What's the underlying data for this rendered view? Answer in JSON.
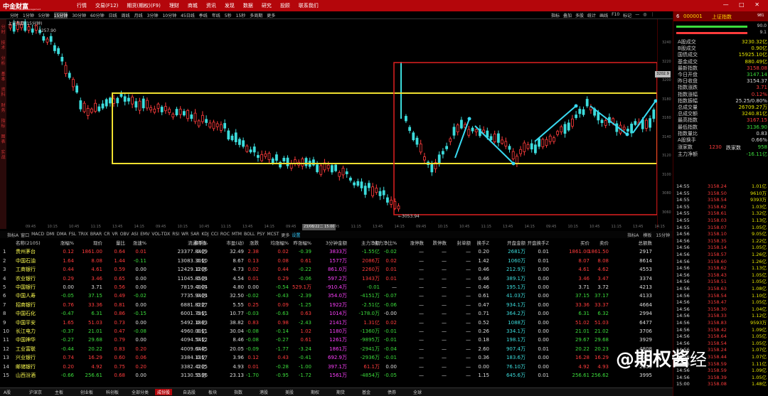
{
  "app": {
    "logo_text": "中金财富",
    "logo_sub": "CICC Wealth Management",
    "menu": [
      "行情",
      "交易(F12)",
      "期货(期权)(F9)",
      "理财",
      "商城",
      "资讯",
      "发现",
      "数据",
      "研究",
      "投顾",
      "联系我们"
    ],
    "window_controls": "— □ ✕"
  },
  "periods": {
    "items": [
      "分时",
      "1分钟",
      "5分钟",
      "15分钟",
      "30分钟",
      "60分钟",
      "日线",
      "周线",
      "月线",
      "3分钟",
      "10分钟",
      "45日线",
      "季线",
      "年线",
      "5秒",
      "15秒",
      "多周期",
      "更多"
    ],
    "active": "15分钟"
  },
  "tools": [
    "指标",
    "叠加",
    "多股",
    "统计",
    "画线",
    "F10",
    "标记",
    "—",
    "◎",
    "⋮"
  ],
  "chart": {
    "title": "上证指数(15分钟)",
    "left_labels": [
      "分时",
      "技术",
      "分析",
      "基本",
      "资料",
      "财务",
      "指标",
      "图表",
      "实战"
    ],
    "y_ticks": [
      "3240",
      "3220",
      "3200",
      "3180",
      "3160",
      "3140",
      "3120",
      "3100",
      "3080",
      "3060"
    ],
    "price_label": "3202.9",
    "low_label": "←3053.94",
    "high_label": "3257.90",
    "time_ticks": [
      "09:45",
      "10:15",
      "10:45",
      "11:15",
      "13:45",
      "14:15",
      "09:45",
      "10:15",
      "10:45",
      "11:15",
      "13:45",
      "14:15",
      "09:45",
      "10:15",
      "10:45",
      "11:15",
      "13:45",
      "14:15",
      "09:45",
      "10:15",
      "10:45",
      "11:15",
      "13:45",
      "14:15",
      "09:45",
      "10:15",
      "10:45",
      "11:15",
      "13:45",
      "14:15",
      "15:00"
    ],
    "date_highlight": "23/08/22二 15:00"
  },
  "indicators": {
    "items": [
      "指标A",
      "窗口",
      "MACD",
      "DMI",
      "DMA",
      "FSL",
      "TRIX",
      "BRAR",
      "CR",
      "VR",
      "OBV",
      "ASI",
      "EMV",
      "VOL-TDX",
      "RSI",
      "WR",
      "SAR",
      "KDJ",
      "CCI",
      "ROC",
      "MTM",
      "BOLL",
      "PSY",
      "MCST",
      "更多",
      "设置"
    ],
    "right": [
      "指标A",
      "模板",
      "15分钟"
    ]
  },
  "table": {
    "headers": [
      "名称(2105)",
      "涨幅%",
      "现价",
      "量比",
      "涨速%",
      "流通市值",
      "换手%",
      "市盈(动)",
      "涨跌",
      "均涨幅%",
      "昨涨幅%",
      "3分钟金额",
      "主力净额",
      "主力净比%",
      "涨停数",
      "跌停数",
      "封单额",
      "换手Z",
      "开盘金额",
      "开盘换手Z",
      "买价",
      "卖价",
      "总额数"
    ],
    "rows": [
      {
        "idx": "1",
        "name": "贵州茅台",
        "c": [
          "0.12",
          "1861.00",
          "0.64",
          "0.01",
          "23377.84亿",
          "0.09",
          "32.49",
          "2.38",
          "0.02",
          "-0.39",
          "3833万",
          "-1.55亿",
          "-0.02",
          "—",
          "—",
          "—",
          "0.20",
          "2681万",
          "0.01",
          "1861.00",
          "1861.50",
          "2917"
        ]
      },
      {
        "idx": "2",
        "name": "中国石油",
        "c": [
          "1.64",
          "8.08",
          "1.44",
          "-0.11",
          "13083.30亿",
          "0.10",
          "8.67",
          "0.13",
          "0.08",
          "0.61",
          "1577万",
          "2086万",
          "0.02",
          "—",
          "—",
          "—",
          "1.42",
          "1060万",
          "0.01",
          "8.07",
          "8.08",
          "8614"
        ]
      },
      {
        "idx": "3",
        "name": "工商银行",
        "c": [
          "0.44",
          "4.61",
          "0.59",
          "0.00",
          "12429.12亿",
          "0.06",
          "4.73",
          "0.02",
          "0.44",
          "-0.22",
          "861.0万",
          "2260万",
          "0.01",
          "—",
          "—",
          "—",
          "0.46",
          "212.9万",
          "0.00",
          "4.61",
          "4.62",
          "4553"
        ]
      },
      {
        "idx": "4",
        "name": "农业银行",
        "c": [
          "0.29",
          "3.46",
          "0.65",
          "0.00",
          "11045.85亿",
          "0.04",
          "4.54",
          "0.01",
          "0.29",
          "-0.06",
          "597.2万",
          "1343万",
          "0.01",
          "—",
          "—",
          "—",
          "0.46",
          "389.1万",
          "0.00",
          "3.46",
          "3.47",
          "3374"
        ]
      },
      {
        "idx": "5",
        "name": "中国银行",
        "c": [
          "0.00",
          "3.71",
          "0.56",
          "0.00",
          "7819.40亿",
          "0.04",
          "4.80",
          "0.00",
          "-0.54",
          "529.1万",
          "-910.4万",
          "-0.01",
          "—",
          "—",
          "—",
          "—",
          "0.46",
          "195.1万",
          "0.00",
          "3.71",
          "3.72",
          "4213"
        ]
      },
      {
        "idx": "6",
        "name": "中国人寿",
        "c": [
          "-0.05",
          "37.15",
          "0.49",
          "-0.02",
          "7735.94亿",
          "0.04",
          "32.50",
          "-0.02",
          "-0.43",
          "-2.39",
          "354.0万",
          "-4151万",
          "-0.07",
          "—",
          "—",
          "—",
          "0.61",
          "41.03万",
          "0.00",
          "37.15",
          "37.17",
          "4133"
        ]
      },
      {
        "idx": "7",
        "name": "招商银行",
        "c": [
          "0.76",
          "33.36",
          "0.81",
          "0.00",
          "6881.82亿",
          "0.27",
          "5.55",
          "0.25",
          "0.09",
          "-1.25",
          "1922万",
          "-2.51亿",
          "-0.06",
          "—",
          "—",
          "—",
          "0.47",
          "934.1万",
          "0.00",
          "33.36",
          "33.37",
          "4664"
        ]
      },
      {
        "idx": "8",
        "name": "中国石化",
        "c": [
          "-0.47",
          "6.31",
          "0.86",
          "-0.15",
          "6001.79亿",
          "0.11",
          "10.77",
          "-0.03",
          "-0.63",
          "0.63",
          "1014万",
          "-178.0万",
          "-0.00",
          "—",
          "—",
          "—",
          "0.71",
          "364.2万",
          "0.00",
          "6.31",
          "6.32",
          "2994"
        ]
      },
      {
        "idx": "9",
        "name": "中国平安",
        "c": [
          "1.65",
          "51.03",
          "0.73",
          "0.00",
          "5492.18亿",
          "0.43",
          "38.82",
          "0.83",
          "0.98",
          "-2.43",
          "2141万",
          "1.31亿",
          "0.02",
          "—",
          "—",
          "—",
          "0.52",
          "1088万",
          "0.00",
          "51.02",
          "51.03",
          "6477"
        ]
      },
      {
        "idx": "10",
        "name": "长江电力",
        "c": [
          "-0.37",
          "21.01",
          "0.47",
          "-0.08",
          "4960.00亿",
          "0.11",
          "30.04",
          "-0.08",
          "-0.14",
          "1.02",
          "1180万",
          "-1360万",
          "-0.01",
          "—",
          "—",
          "—",
          "0.26",
          "334.1万",
          "0.00",
          "21.01",
          "21.02",
          "3706"
        ]
      },
      {
        "idx": "11",
        "name": "中国神华",
        "c": [
          "-0.27",
          "29.68",
          "0.79",
          "0.00",
          "4094.54亿",
          "0.12",
          "8.46",
          "-0.08",
          "-0.27",
          "0.61",
          "1261万",
          "-9895万",
          "-0.01",
          "—",
          "—",
          "—",
          "0.18",
          "198.1万",
          "0.00",
          "29.67",
          "29.68",
          "3929"
        ]
      },
      {
        "idx": "12",
        "name": "工业富联",
        "c": [
          "-0.44",
          "20.22",
          "0.83",
          "0.20",
          "4009.64亿",
          "0.45",
          "20.05",
          "-0.09",
          "-1.77",
          "-3.24",
          "1861万",
          "-2941万",
          "-0.04",
          "—",
          "—",
          "—",
          "2.60",
          "907.4万",
          "0.01",
          "20.22",
          "20.23",
          "4808"
        ]
      },
      {
        "idx": "13",
        "name": "兴业银行",
        "c": [
          "0.74",
          "16.29",
          "0.60",
          "0.06",
          "3384.13亿",
          "0.17",
          "3.96",
          "0.12",
          "0.43",
          "-0.41",
          "692.9万",
          "-2936万",
          "-0.01",
          "—",
          "—",
          "—",
          "0.36",
          "183.6万",
          "0.00",
          "16.28",
          "16.29",
          "3725"
        ]
      },
      {
        "idx": "14",
        "name": "邮储银行",
        "c": [
          "0.20",
          "4.92",
          "0.75",
          "0.20",
          "3382.42亿",
          "0.05",
          "4.93",
          "0.01",
          "-0.28",
          "-1.00",
          "397.1万",
          "61.1万",
          "0.00",
          "—",
          "—",
          "—",
          "0.00",
          "76.10万",
          "0.00",
          "4.92",
          "4.93",
          "2659"
        ]
      },
      {
        "idx": "15",
        "name": "山西汾酒",
        "c": [
          "-0.66",
          "256.61",
          "0.68",
          "0.00",
          "3130.55亿",
          "0.36",
          "23.13",
          "-1.70",
          "-0.95",
          "-1.72",
          "1561万",
          "-4854万",
          "-0.05",
          "—",
          "—",
          "—",
          "1.15",
          "645.6万",
          "0.01",
          "256.61",
          "256.62",
          "3995"
        ]
      }
    ]
  },
  "bottom_tabs": [
    "A股",
    "沪深京",
    "主板",
    "创业板",
    "科创板",
    "全部分类",
    "成份股",
    "自选股",
    "板块",
    "指数",
    "港股",
    "美股",
    "期权",
    "期货",
    "基金",
    "债券",
    "全球"
  ],
  "bottom_active": "成份股",
  "right_panel": {
    "head_num": "6",
    "code": "000001",
    "name": "上证指数",
    "right": "981",
    "mini": [
      "90.0",
      "9.1"
    ],
    "stats": [
      {
        "k": "A股成交",
        "v": "3230.32亿",
        "c": "yl"
      },
      {
        "k": "B股成交",
        "v": "0.90亿",
        "c": "yl"
      },
      {
        "k": "国债成交",
        "v": "15925.10亿",
        "c": "yl"
      },
      {
        "k": "基金成交",
        "v": "880.49亿",
        "c": "yl"
      },
      {
        "k": "最新指数",
        "v": "3158.08",
        "c": "up"
      },
      {
        "k": "今日开盘",
        "v": "3147.14",
        "c": "dn"
      },
      {
        "k": "昨日收盘",
        "v": "3154.37",
        "c": "wh"
      },
      {
        "k": "指数涨跌",
        "v": "3.71",
        "c": "up"
      },
      {
        "k": "指数涨幅",
        "v": "0.12%",
        "c": "up"
      },
      {
        "k": "指数振幅",
        "v": "25.25/0.80%",
        "c": "wh"
      },
      {
        "k": "总成交量",
        "v": "26709.27万",
        "c": "yl"
      },
      {
        "k": "总成交额",
        "v": "3240.81亿",
        "c": "yl"
      },
      {
        "k": "最高指数",
        "v": "3167.15",
        "c": "up"
      },
      {
        "k": "最低指数",
        "v": "3136.90",
        "c": "dn"
      },
      {
        "k": "指数量比",
        "v": "0.83",
        "c": "wh"
      },
      {
        "k": "A股换手",
        "v": "0.66%",
        "c": "wh"
      }
    ],
    "updown": {
      "k": "涨家数",
      "v": "1230",
      "k2": "跌家数",
      "v2": "958"
    },
    "flow": {
      "k": "主力净额",
      "v": "-16.11亿"
    },
    "ticks": [
      [
        "14:55",
        "3158.24",
        "1.01亿"
      ],
      [
        "14:55",
        "3158.50",
        "9610万"
      ],
      [
        "14:55",
        "3158.54",
        "9393万"
      ],
      [
        "14:55",
        "3158.62",
        "1.03亿"
      ],
      [
        "14:55",
        "3158.61",
        "1.32亿"
      ],
      [
        "14:55",
        "3158.03",
        "1.13亿"
      ],
      [
        "14:55",
        "3158.07",
        "1.05亿"
      ],
      [
        "14:56",
        "3158.10",
        "9.05亿"
      ],
      [
        "14:56",
        "3158.35",
        "1.22亿"
      ],
      [
        "14:56",
        "3158.14",
        "1.05亿"
      ],
      [
        "14:56",
        "3158.57",
        "1.26亿"
      ],
      [
        "14:56",
        "3158.60",
        "1.26亿"
      ],
      [
        "14:56",
        "3158.62",
        "1.13亿"
      ],
      [
        "14:56",
        "3158.43",
        "1.05亿"
      ],
      [
        "14:56",
        "3158.51",
        "1.05亿"
      ],
      [
        "14:56",
        "3158.63",
        "1.08亿"
      ],
      [
        "14:56",
        "3158.54",
        "1.10亿"
      ],
      [
        "14:56",
        "3158.47",
        "1.05亿"
      ],
      [
        "14:56",
        "3158.30",
        "1.04亿"
      ],
      [
        "14:56",
        "3158.33",
        "1.12亿"
      ],
      [
        "14:56",
        "3158.83",
        "9593万"
      ],
      [
        "14:56",
        "3158.42",
        "1.09亿"
      ],
      [
        "14:56",
        "3158.64",
        "1.05亿"
      ],
      [
        "14:56",
        "3158.54",
        "1.05亿"
      ],
      [
        "14:56",
        "3158.24",
        "1.07亿"
      ],
      [
        "14:56",
        "3158.44",
        "1.07亿"
      ],
      [
        "14:56",
        "3158.59",
        "1.11亿"
      ],
      [
        "14:56",
        "3158.59",
        "1.09亿"
      ],
      [
        "14:56",
        "3158.39",
        "1.05亿"
      ],
      [
        "15:00",
        "3158.08",
        "1.48亿"
      ]
    ]
  },
  "watermark": {
    "main": "@期权酱",
    "tail": "经"
  }
}
